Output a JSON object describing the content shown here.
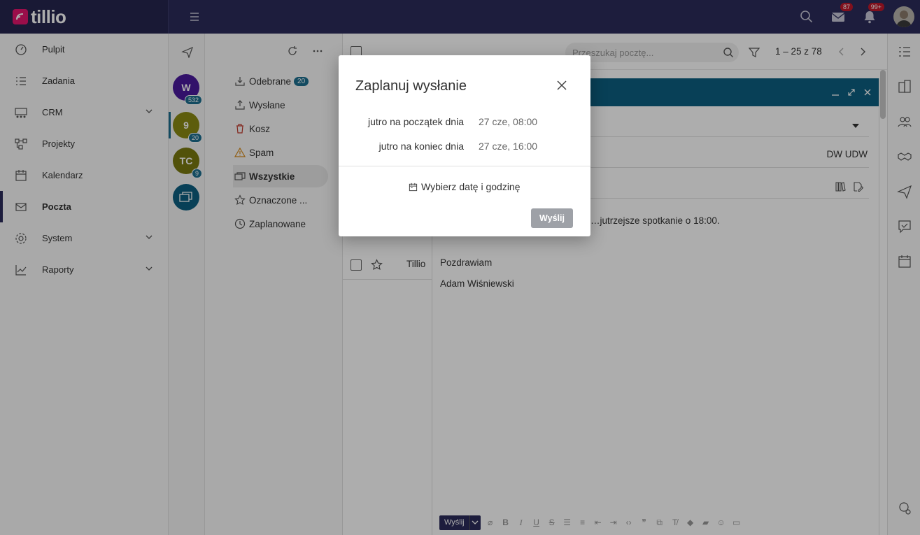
{
  "brand": {
    "name": "tillio"
  },
  "topbar": {
    "mail_badge": "87",
    "notif_badge": "99+"
  },
  "sidebar": {
    "items": [
      {
        "label": "Pulpit"
      },
      {
        "label": "Zadania"
      },
      {
        "label": "CRM"
      },
      {
        "label": "Projekty"
      },
      {
        "label": "Kalendarz"
      },
      {
        "label": "Poczta"
      },
      {
        "label": "System"
      },
      {
        "label": "Raporty"
      }
    ]
  },
  "accounts": [
    {
      "initial": "W",
      "badge": "532",
      "color": "#4a1a9c"
    },
    {
      "initial": "9",
      "badge": "20",
      "color": "#8a8a12"
    },
    {
      "initial": "TC",
      "badge": "9",
      "color": "#7a7a10"
    },
    {
      "initial": "",
      "badge": "",
      "color": "#0d5f80"
    }
  ],
  "folders": [
    {
      "label": "Odebrane",
      "badge": "20"
    },
    {
      "label": "Wysłane"
    },
    {
      "label": "Kosz"
    },
    {
      "label": "Spam"
    },
    {
      "label": "Wszystkie"
    },
    {
      "label": "Oznaczone ..."
    },
    {
      "label": "Zaplanowane"
    }
  ],
  "list": {
    "search_placeholder": "Przeszukaj pocztę...",
    "pager": "1 – 25 z 78",
    "row_sender": "Tillio"
  },
  "compose": {
    "cc_label": "DW UDW",
    "body_line1": "…jutrzejsze spotkanie o 18:00.",
    "body_line2": "Pozdrawiam",
    "body_line3": "Adam Wiśniewski",
    "send_label": "Wyślij"
  },
  "modal": {
    "title": "Zaplanuj wysłanie",
    "options": [
      {
        "label": "jutro na początek dnia",
        "value": "27 cze, 08:00"
      },
      {
        "label": "jutro na koniec dnia",
        "value": "27 cze, 16:00"
      }
    ],
    "pick_label": "Wybierz datę i godzinę",
    "send_label": "Wyślij"
  },
  "colors": {
    "nav": "#2b2c5a",
    "accent": "#0d5f80",
    "brand": "#e4166e",
    "badge": "#c0192b"
  }
}
